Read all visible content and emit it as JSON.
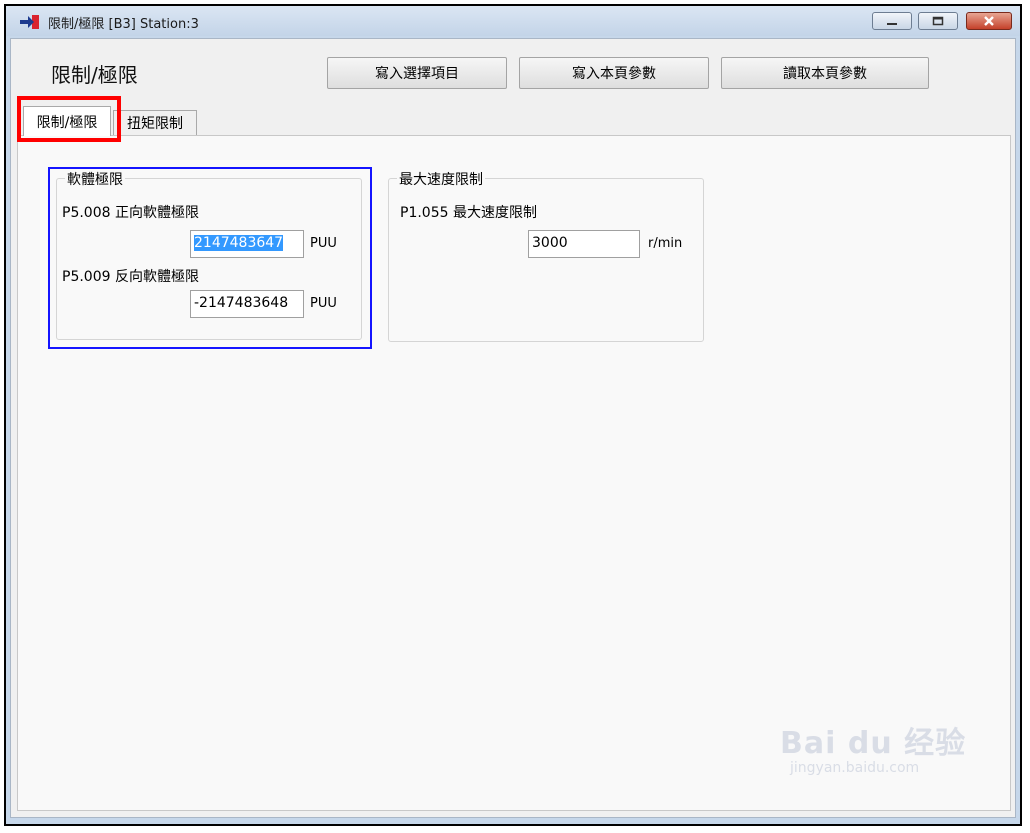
{
  "window": {
    "title": "限制/極限 [B3] Station:3"
  },
  "toolbar": {
    "heading": "限制/極限",
    "write_selected_label": "寫入選擇項目",
    "write_page_label": "寫入本頁參數",
    "read_page_label": "讀取本頁參數"
  },
  "tabs": [
    {
      "label": "限制/極限",
      "active": true
    },
    {
      "label": "扭矩限制",
      "active": false
    }
  ],
  "software_limit": {
    "title": "軟體極限",
    "forward": {
      "label": "P5.008 正向軟體極限",
      "value": "2147483647",
      "unit": "PUU"
    },
    "reverse": {
      "label": "P5.009 反向軟體極限",
      "value": "-2147483648",
      "unit": "PUU"
    }
  },
  "speed_limit": {
    "title": "最大速度限制",
    "max_speed": {
      "label": "P1.055 最大速度限制",
      "value": "3000",
      "unit": "r/min"
    }
  },
  "watermark": {
    "logo": "Bai du 经验",
    "url": "jingyan.baidu.com"
  },
  "colors": {
    "highlight_red": "#ff0000",
    "highlight_blue": "#1414ff",
    "selection": "#3399ff"
  }
}
